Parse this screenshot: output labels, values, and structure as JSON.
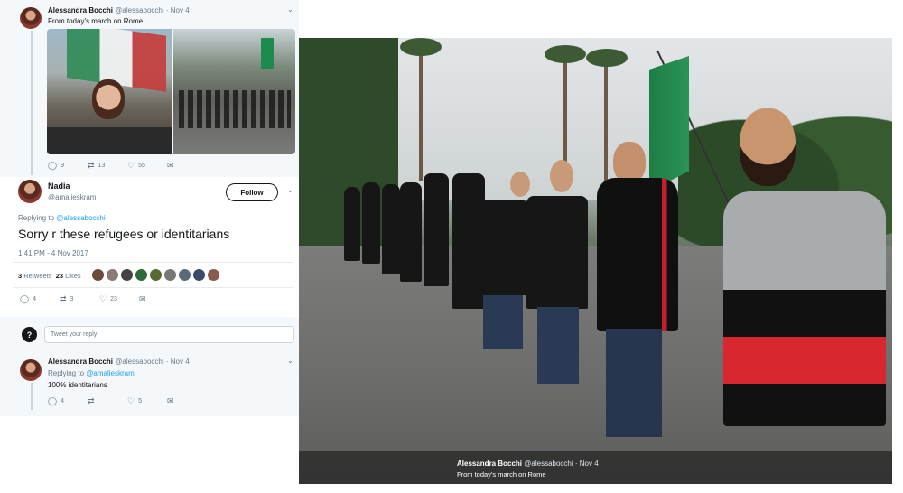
{
  "tweet1": {
    "name": "Alessandra Bocchi",
    "handle": "@alessabocchi",
    "date": "· Nov 4",
    "text": "From today's march on Rome",
    "replies": "9",
    "retweets": "13",
    "likes": "55"
  },
  "tweet2": {
    "name": "Nadia",
    "handle": "@amalieskram",
    "follow_label": "Follow",
    "replying_prefix": "Replying to",
    "replying_to": "@alessabocchi",
    "text": "Sorry r these refugees or identitarians",
    "timestamp": "1:41 PM - 4 Nov 2017",
    "retweets_count": "3",
    "retweets_label": "Retweets",
    "likes_count": "23",
    "likes_label": "Likes",
    "replies": "4",
    "retweets": "3",
    "likes": "23"
  },
  "reply_box": {
    "placeholder": "Tweet your reply"
  },
  "tweet3": {
    "name": "Alessandra Bocchi",
    "handle": "@alessabocchi",
    "date": "· Nov 4",
    "replying_prefix": "Replying to",
    "replying_to": "@amalieskram",
    "text": "100% identitarians",
    "replies": "4",
    "likes": "5"
  },
  "photo_caption": {
    "name": "Alessandra Bocchi",
    "handle": "@alessabocchi",
    "date": "· Nov 4",
    "text": "From today's march on Rome"
  },
  "colors": {
    "link": "#1da1f2",
    "secondary_text": "#657786",
    "thread_bg": "#f5f8fa"
  },
  "icons": [
    "reply-icon",
    "retweet-icon",
    "like-icon",
    "dm-icon",
    "chevron-down-icon"
  ]
}
